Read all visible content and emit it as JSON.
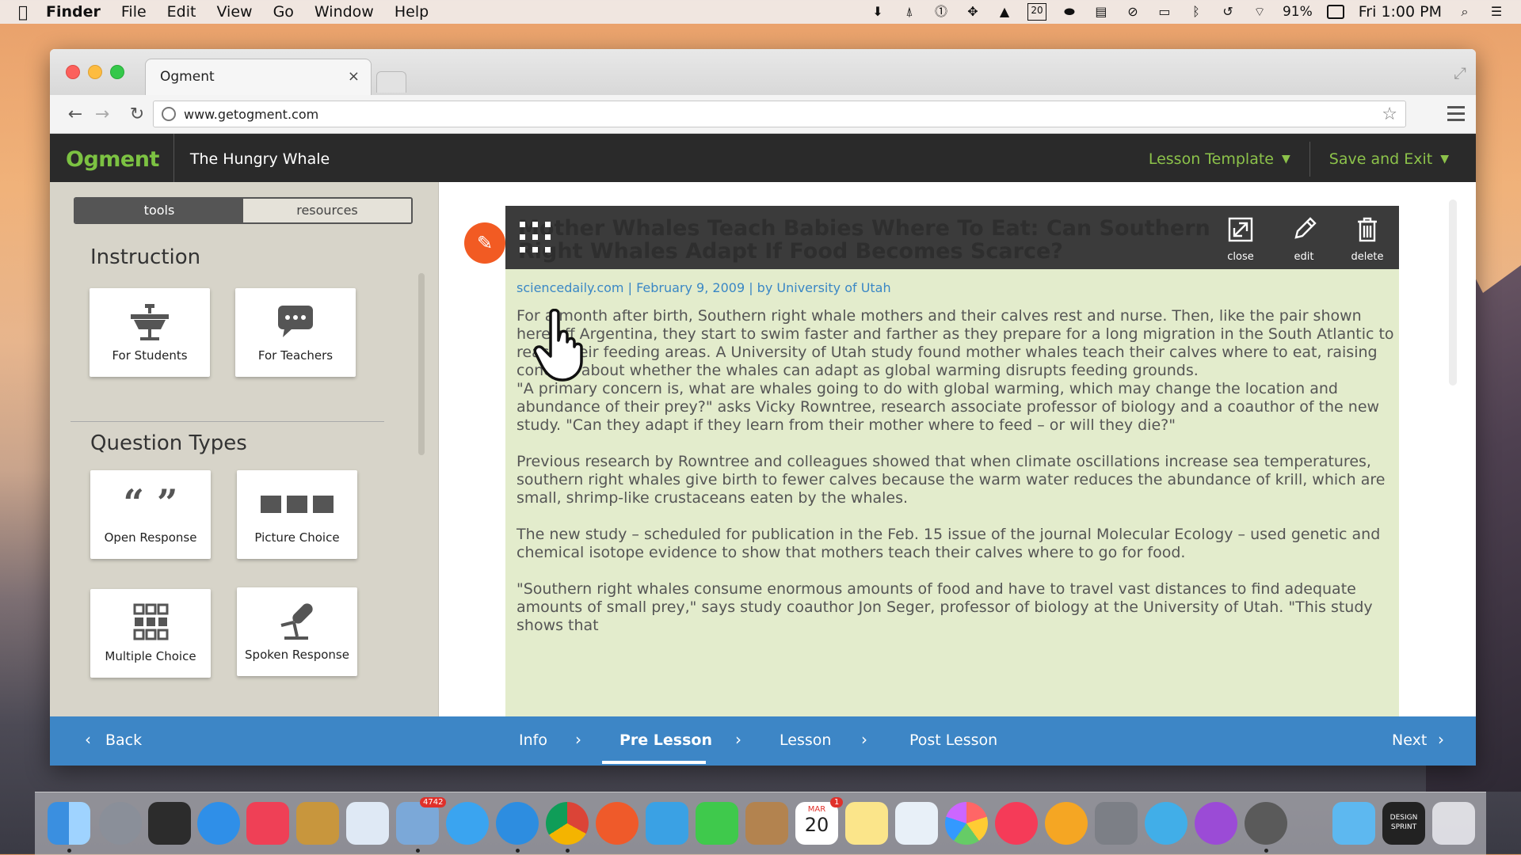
{
  "menubar": {
    "app": "Finder",
    "items": [
      "File",
      "Edit",
      "View",
      "Go",
      "Window",
      "Help"
    ],
    "calendar_day": "20",
    "battery": "91%",
    "clock": "Fri 1:00 PM"
  },
  "browser": {
    "tab_title": "Ogment",
    "tab_close": "×",
    "url": "www.getogment.com"
  },
  "app": {
    "logo": "Ogment",
    "lesson_title": "The Hungry Whale",
    "lesson_template": "Lesson Template",
    "save_exit": "Save and Exit",
    "accent": "#7cc242"
  },
  "sidebar": {
    "tabs": {
      "tools": "tools",
      "resources": "resources"
    },
    "instruction_title": "Instruction",
    "instruction": [
      {
        "label": "For Students",
        "icon": "desk-icon"
      },
      {
        "label": "For Teachers",
        "icon": "speech-bubble-icon"
      }
    ],
    "question_types_title": "Question Types",
    "question_types": [
      {
        "label": "Open Response",
        "icon": "quote-icon"
      },
      {
        "label": "Picture Choice",
        "icon": "picture-blocks-icon"
      },
      {
        "label": "Multiple Choice",
        "icon": "grid-icon"
      },
      {
        "label": "Spoken Response",
        "icon": "microphone-icon"
      }
    ]
  },
  "card": {
    "title": "Mother Whales Teach Babies Where To Eat: Can Southern Right Whales Adapt If Food Becomes Scarce?",
    "actions": {
      "close": "close",
      "edit": "edit",
      "delete": "delete"
    },
    "meta": "sciencedaily.com  |  February 9, 2009  |  by University of Utah",
    "paragraphs": [
      "For a month after birth, Southern right whale mothers and their calves rest and nurse. Then, like the pair shown here off Argentina, they start to swim faster and farther as they prepare for a long migration in the South Atlantic to reach their feeding areas. A University of Utah study found mother whales teach their calves where to eat, raising concern about whether the whales can adapt as global warming disrupts feeding grounds.",
      "\"A primary concern is, what are whales going to do with global warming, which may change the location and abundance of their prey?\" asks Vicky Rowntree, research associate professor of biology and a coauthor of the new study. \"Can they adapt if they learn from their mother where to feed – or will they die?\"",
      "Previous research by Rowntree and colleagues showed that when climate oscillations increase sea temperatures, southern right whales give birth to fewer calves because the warm water reduces the abundance of krill, which are small, shrimp-like crustaceans eaten by the whales.",
      "The new study – scheduled for publication in the Feb. 15 issue of the journal Molecular Ecology – used genetic and chemical isotope evidence to show that mothers teach their calves where to go for food.",
      "\"Southern right whales consume enormous amounts of food and have to travel vast distances to find adequate amounts of small prey,\" says study coauthor Jon Seger, professor of biology at the University of Utah. \"This study shows that"
    ]
  },
  "bottomnav": {
    "back": "Back",
    "steps": [
      "Info",
      "Pre Lesson",
      "Lesson",
      "Post Lesson"
    ],
    "active_step": "Pre Lesson",
    "next": "Next",
    "color": "#3d86c6"
  },
  "dock": {
    "mail_badge": "4742",
    "calendar_month": "MAR",
    "calendar_day": "20",
    "calendar_badge": "1",
    "design_sprint": "DESIGN SPRINT"
  }
}
